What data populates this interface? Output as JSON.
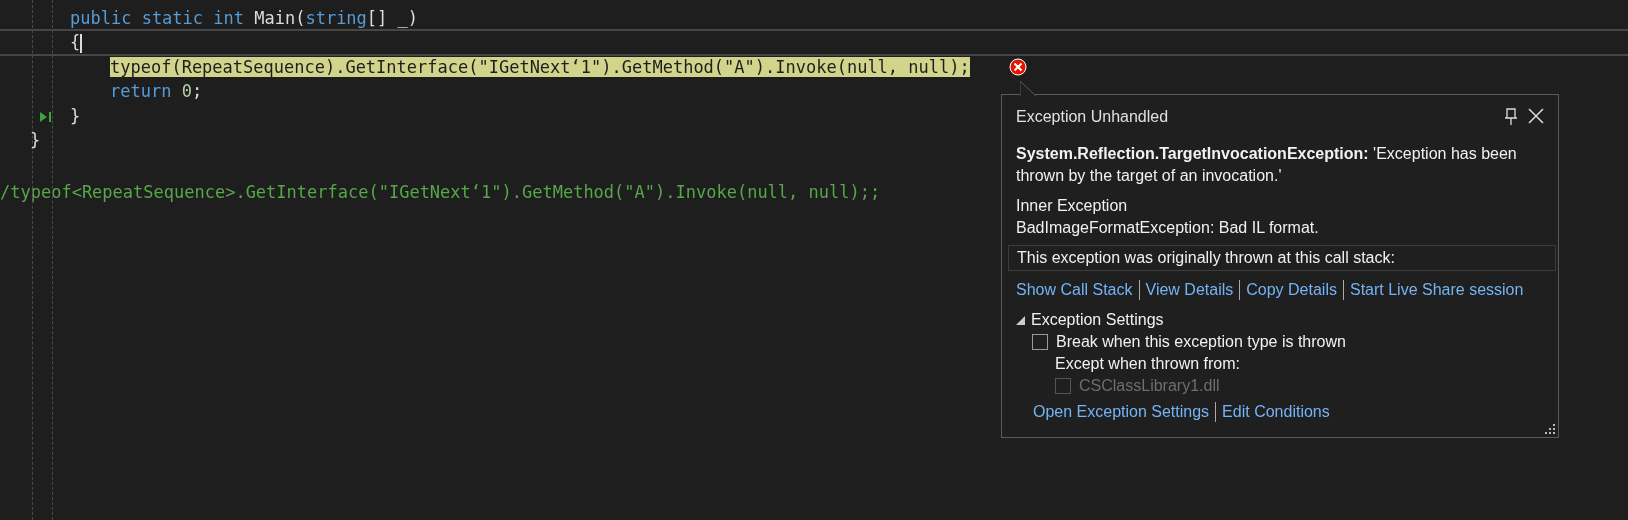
{
  "code": {
    "children": [
      {
        "lines": [
          {
            "caret": false,
            "highlighted": false,
            "tokens": [
              {
                "kind": "keyword",
                "text": "public static int "
              },
              {
                "kind": "plain",
                "text": "Main("
              },
              {
                "kind": "keyword",
                "text": "string"
              },
              {
                "kind": "plain",
                "text": "[] _)"
              }
            ]
          },
          {
            "caret": true,
            "highlighted": false,
            "tokens": [
              {
                "kind": "plain",
                "text": "{"
              }
            ]
          }
        ],
        "children": [
          {
            "lines": [
              {
                "caret": false,
                "highlighted": true,
                "error": true,
                "tokens": [
                  {
                    "kind": "plain",
                    "text": "typeof(RepeatSequence).GetInterface(\"IGetNext‘1\").GetMethod(\"A\").Invoke(null, null);"
                  }
                ]
              },
              {
                "caret": false,
                "highlighted": false,
                "tokens": [
                  {
                    "kind": "keyword",
                    "text": "return "
                  },
                  {
                    "kind": "number",
                    "text": "0"
                  },
                  {
                    "kind": "plain",
                    "text": ";"
                  }
                ]
              }
            ]
          }
        ],
        "closing": {
          "caret": false,
          "highlighted": false,
          "run_to_cursor": true,
          "tokens": [
            {
              "kind": "plain",
              "text": "}"
            }
          ]
        }
      }
    ],
    "closing": {
      "caret": false,
      "highlighted": false,
      "tokens": [
        {
          "kind": "plain",
          "text": "}"
        }
      ]
    }
  },
  "comment_line": "/typeof<RepeatSequence>.GetInterface(\"IGetNext‘1\").GetMethod(\"A\").Invoke(null, null);;",
  "exception_popup": {
    "title": "Exception Unhandled",
    "message": "**System.Reflection.TargetInvocationException:** 'Exception has been thrown by the target of an invocation.'",
    "inner_label": "Inner Exception",
    "inner_message": "BadImageFormatException: Bad IL format.",
    "call_stack_note": "This exception was originally thrown at this call stack:",
    "links": [
      "Show Call Stack",
      "View Details",
      "Copy Details",
      "Start Live Share session"
    ],
    "settings": {
      "title": "Exception Settings",
      "expanded": true,
      "break_option": {
        "label": "Break when this exception type is thrown",
        "checked": false
      },
      "except_label": "Except when thrown from:",
      "module_option": {
        "label": "CSClassLibrary1.dll",
        "checked": false,
        "disabled": true
      }
    },
    "bottom_links": [
      "Open Exception Settings",
      "Edit Conditions"
    ]
  }
}
